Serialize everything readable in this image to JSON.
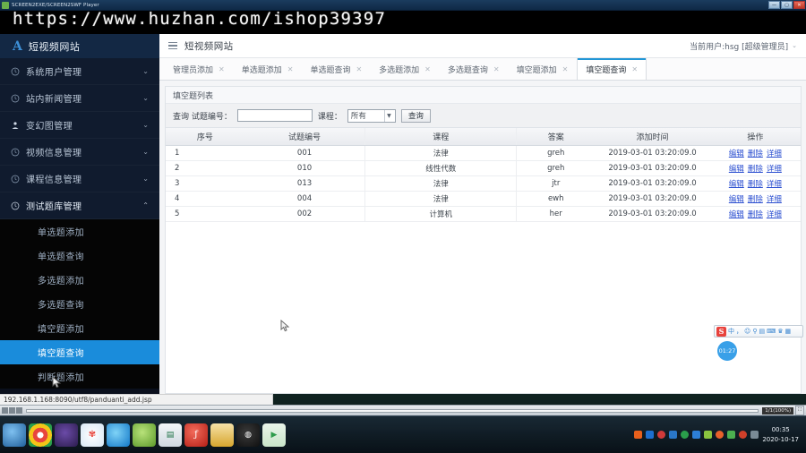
{
  "window": {
    "title": "SCREEN2EXE/SCREEN2SWF Player",
    "minimize": "—",
    "maximize": "▢",
    "close": "✕"
  },
  "watermark": "https://www.huzhan.com/ishop39397",
  "brand": {
    "logo": "A",
    "name": "短视频网站"
  },
  "sidebar": {
    "items": [
      {
        "label": "系统用户管理",
        "icon": "settings-icon",
        "chevron": "⌄"
      },
      {
        "label": "站内新闻管理",
        "icon": "settings-icon",
        "chevron": "⌄"
      },
      {
        "label": "变幻图管理",
        "icon": "user-icon",
        "chevron": "⌄"
      },
      {
        "label": "视频信息管理",
        "icon": "settings-icon",
        "chevron": "⌄"
      },
      {
        "label": "课程信息管理",
        "icon": "settings-icon",
        "chevron": "⌄"
      },
      {
        "label": "测试题库管理",
        "icon": "settings-icon",
        "chevron": "⌃"
      }
    ],
    "submenu": [
      {
        "label": "单选题添加",
        "active": false
      },
      {
        "label": "单选题查询",
        "active": false
      },
      {
        "label": "多选题添加",
        "active": false
      },
      {
        "label": "多选题查询",
        "active": false
      },
      {
        "label": "填空题添加",
        "active": false
      },
      {
        "label": "填空题查询",
        "active": true
      },
      {
        "label": "判断题添加",
        "active": false
      }
    ],
    "active_color": "#1a8cdb"
  },
  "topbar": {
    "title": "短视频网站",
    "hamburger": "menu-icon",
    "user": "当前用户:hsg [超级管理员]",
    "user_chevron": "⌄"
  },
  "tabs": [
    {
      "label": "管理员添加",
      "close": "✕",
      "active": false
    },
    {
      "label": "单选题添加",
      "close": "✕",
      "active": false
    },
    {
      "label": "单选题查询",
      "close": "✕",
      "active": false
    },
    {
      "label": "多选题添加",
      "close": "✕",
      "active": false
    },
    {
      "label": "多选题查询",
      "close": "✕",
      "active": false
    },
    {
      "label": "填空题添加",
      "close": "✕",
      "active": false
    },
    {
      "label": "填空题查询",
      "close": "✕",
      "active": true
    }
  ],
  "panel": {
    "heading": "填空题列表",
    "search": {
      "prefix_label": "查询 试题编号：",
      "input_value": "",
      "input_placeholder": "",
      "course_label": "课程：",
      "course_value": "所有",
      "course_arrow": "▼",
      "submit_label": "查询"
    },
    "table": {
      "headers": [
        "序号",
        "试题编号",
        "课程",
        "答案",
        "添加时间",
        "操作"
      ],
      "actions": [
        "编辑",
        "删除",
        "详细"
      ],
      "rows": [
        {
          "idx": "1",
          "code": "001",
          "course": "法律",
          "answer": "greh",
          "time": "2019-03-01 03:20:09.0"
        },
        {
          "idx": "2",
          "code": "010",
          "course": "线性代数",
          "answer": "greh",
          "time": "2019-03-01 03:20:09.0"
        },
        {
          "idx": "3",
          "code": "013",
          "course": "法律",
          "answer": "jtr",
          "time": "2019-03-01 03:20:09.0"
        },
        {
          "idx": "4",
          "code": "004",
          "course": "法律",
          "answer": "ewh",
          "time": "2019-03-01 03:20:09.0"
        },
        {
          "idx": "5",
          "code": "002",
          "course": "计算机",
          "answer": "her",
          "time": "2019-03-01 03:20:09.0"
        }
      ]
    }
  },
  "statusbar": "192.168.1.168:8090/utf8/panduanti_add.jsp",
  "ime": {
    "logo": "S",
    "glyphs": [
      "中",
      "，",
      "☺",
      "⚲",
      "▤",
      "⌨",
      "♛",
      "▦"
    ],
    "badge": "01:27"
  },
  "player_controls": {
    "buttons": [
      "▶",
      "⏸",
      "⏹"
    ],
    "right_label": "1/1(100%)",
    "right_box": "⛶"
  },
  "taskbar": {
    "apps": [
      {
        "name": "start-orb-icon",
        "glyph": "◉",
        "color": "#3b7fbf"
      },
      {
        "name": "chrome-icon",
        "glyph": "◍",
        "color": "#e8453c"
      },
      {
        "name": "eclipse-icon",
        "glyph": "◐",
        "color": "#3c2a5e"
      },
      {
        "name": "app-icon",
        "glyph": "✾",
        "color": "#2196d6"
      },
      {
        "name": "360-browser-icon",
        "glyph": "◗",
        "color": "#1e8fd6"
      },
      {
        "name": "leaf-app-icon",
        "glyph": "❦",
        "color": "#7cbf3f"
      },
      {
        "name": "excel-icon",
        "glyph": "▤",
        "color": "#1e7145"
      },
      {
        "name": "flash-icon",
        "glyph": "ƒ",
        "color": "#d92e2e"
      },
      {
        "name": "folder-icon",
        "glyph": "▭",
        "color": "#e8b23c"
      },
      {
        "name": "qq-icon",
        "glyph": "◍",
        "color": "#1b1b1b"
      },
      {
        "name": "powerpoint-icon",
        "glyph": "▶",
        "color": "#2f9c4c"
      }
    ],
    "tray": [
      "#e8601c",
      "#1e6fd0",
      "#d03a3a",
      "#2a77c8",
      "#2a9f4b",
      "#2d7fd6",
      "#8ac43f",
      "#e8612b",
      "#4caf50",
      "#d0402a",
      "#7a8b96"
    ],
    "clock_time": "00:35",
    "clock_date": "2020-10-17"
  }
}
